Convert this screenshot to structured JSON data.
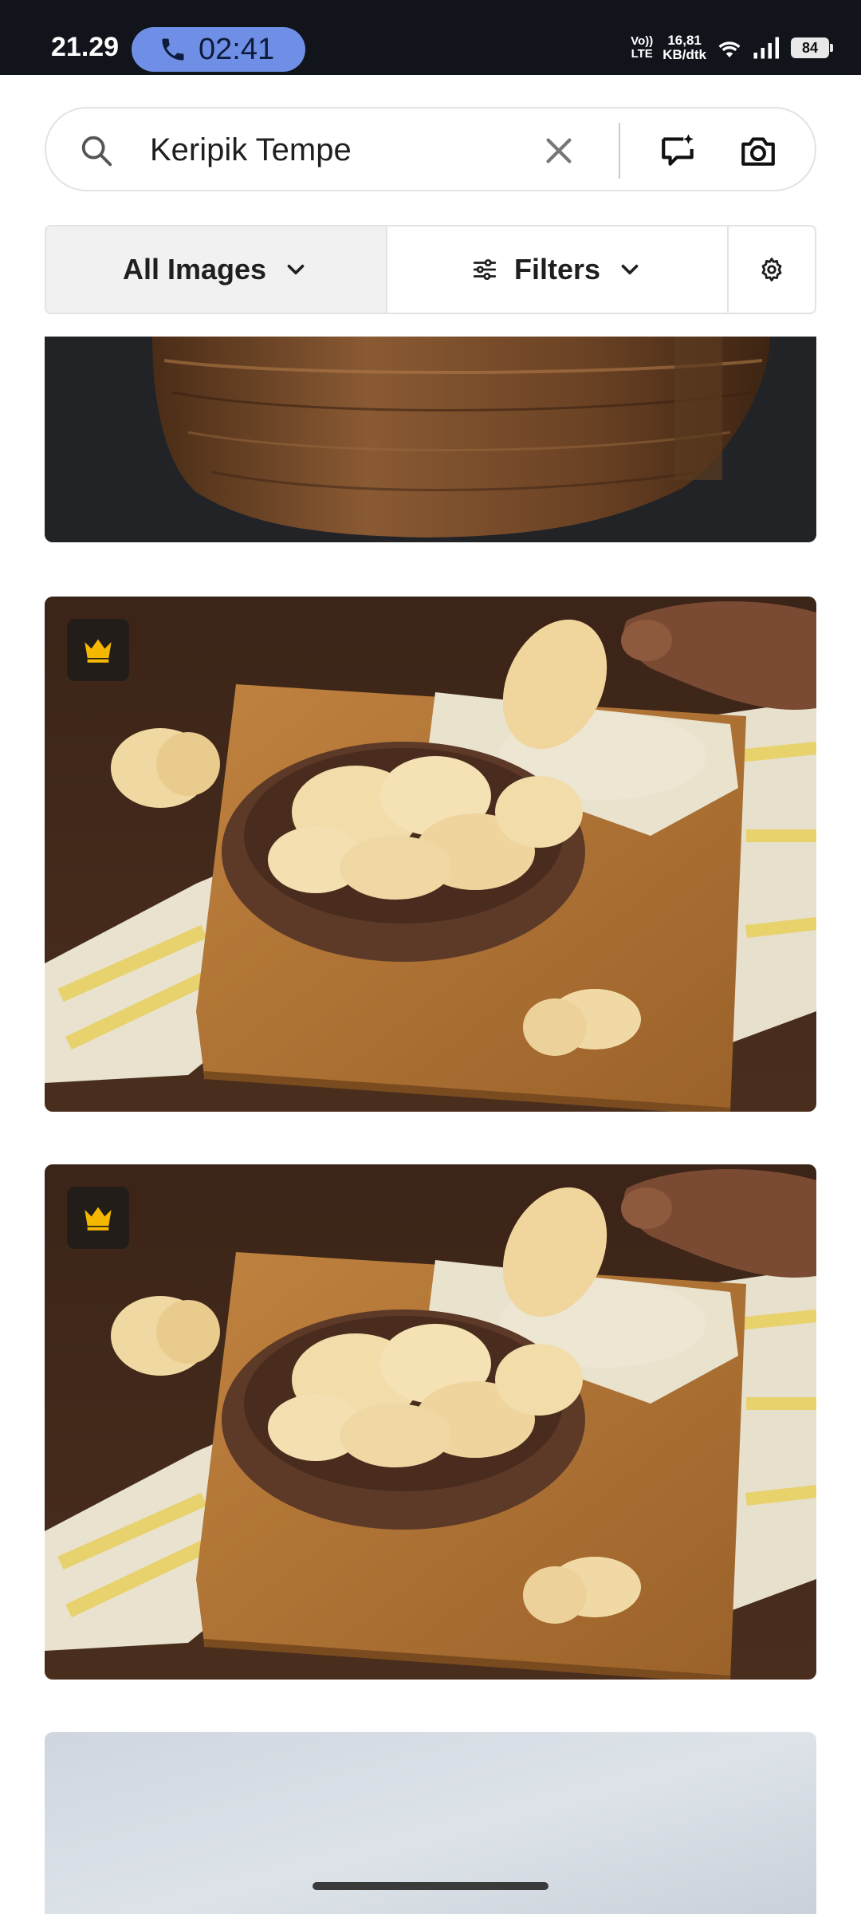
{
  "status_bar": {
    "time": "21.29",
    "call_timer": "02:41",
    "volte_label": "Vo))\nLTE",
    "net_speed_value": "16,81",
    "net_speed_unit": "KB/dtk",
    "battery_level": "84"
  },
  "search": {
    "query": "Keripik Tempe",
    "icons": [
      "search-icon",
      "clear-icon",
      "ai-search-icon",
      "camera-icon"
    ]
  },
  "filters": {
    "scope_label": "All Images",
    "filters_label": "Filters",
    "icons": [
      "chevron-down-icon",
      "sliders-icon",
      "gear-icon"
    ]
  },
  "results": [
    {
      "name": "result-image-1",
      "premium": false,
      "partial": "top-cropped"
    },
    {
      "name": "result-image-2",
      "premium": true
    },
    {
      "name": "result-image-3",
      "premium": true
    },
    {
      "name": "result-image-4",
      "premium": false,
      "partial": "bottom-cropped"
    }
  ],
  "colors": {
    "status_bar_bg": "#11141b",
    "call_pill": "#6f8fe6",
    "premium_crown": "#f5b800",
    "premium_badge_bg": "#221d18",
    "active_segment_bg": "#f1f1f1"
  }
}
